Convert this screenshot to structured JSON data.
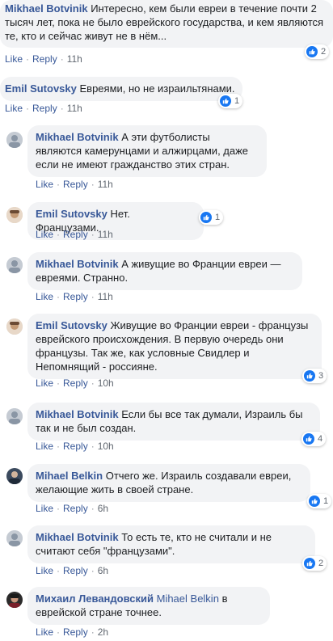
{
  "labels": {
    "like": "Like",
    "reply": "Reply"
  },
  "colors": {
    "name": "#385898",
    "bubble": "#f2f3f5",
    "like_icon": "#1877f2"
  },
  "comments": [
    {
      "author": "Mikhael Botvinik",
      "text": "Интересно, кем были евреи в течение почти 2 тысяч лет, пока не было еврейского государства, и кем являются те, кто и сейчас живут не в нём...",
      "time": "11h",
      "reactions": "2"
    },
    {
      "author": "Emil Sutovsky",
      "text": "Евреями, но не израильтянами.",
      "time": "11h",
      "reactions": "1"
    },
    {
      "author": "Mikhael Botvinik",
      "text": "А эти футболисты являются камерунцами и алжирцами, даже если не имеют гражданство этих стран.",
      "time": "11h",
      "reactions": ""
    },
    {
      "author": "Emil Sutovsky",
      "text": "Нет. Французами.",
      "time": "11h",
      "reactions": "1"
    },
    {
      "author": "Mikhael Botvinik",
      "text": "А живущие во Франции евреи — евреями. Странно.",
      "time": "11h",
      "reactions": ""
    },
    {
      "author": "Emil Sutovsky",
      "text": "Живущие во Франции евреи - французы еврейского происхождения. В первую очередь они французы. Так же, как условные Свидлер и Непомнящий - россияне.",
      "time": "10h",
      "reactions": "3"
    },
    {
      "author": "Mikhael Botvinik",
      "text": "Если бы все так думали, Израиль бы так и не был создан.",
      "time": "10h",
      "reactions": "4"
    },
    {
      "author": "Mihael Belkin",
      "text": "Отчего же. Израиль создавали евреи, желающие жить в своей стране.",
      "time": "6h",
      "reactions": "1"
    },
    {
      "author": "Mikhael Botvinik",
      "text": "То есть те, кто не считали и не считают себя \"французами\".",
      "time": "6h",
      "reactions": "2"
    },
    {
      "author": "Михаил Левандовский",
      "mention": "Mihael Belkin",
      "text": "в еврейской стране точнее.",
      "time": "2h",
      "reactions": ""
    }
  ]
}
